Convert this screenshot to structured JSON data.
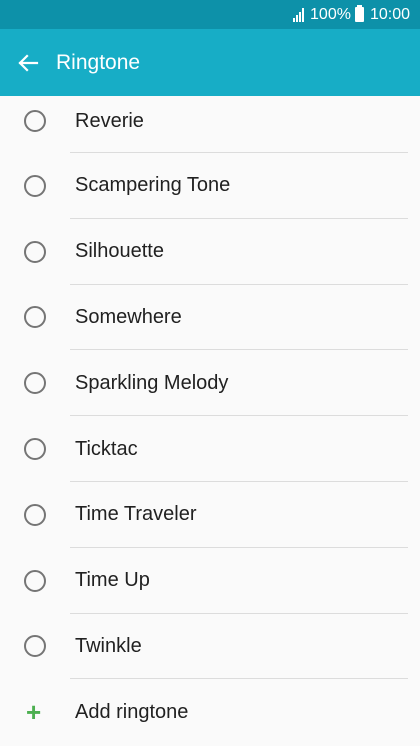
{
  "status_bar": {
    "battery_percent": "100%",
    "time": "10:00"
  },
  "app_bar": {
    "title": "Ringtone",
    "back_icon": "arrow-left-icon"
  },
  "ringtones": [
    {
      "label": "Reverie"
    },
    {
      "label": "Scampering Tone"
    },
    {
      "label": "Silhouette"
    },
    {
      "label": "Somewhere"
    },
    {
      "label": "Sparkling Melody"
    },
    {
      "label": "Ticktac"
    },
    {
      "label": "Time Traveler"
    },
    {
      "label": "Time Up"
    },
    {
      "label": "Twinkle"
    }
  ],
  "add_ringtone": {
    "label": "Add ringtone",
    "icon": "plus-icon"
  },
  "colors": {
    "status_bar": "#0d91a9",
    "app_bar": "#17adc6",
    "plus": "#4caf50"
  }
}
